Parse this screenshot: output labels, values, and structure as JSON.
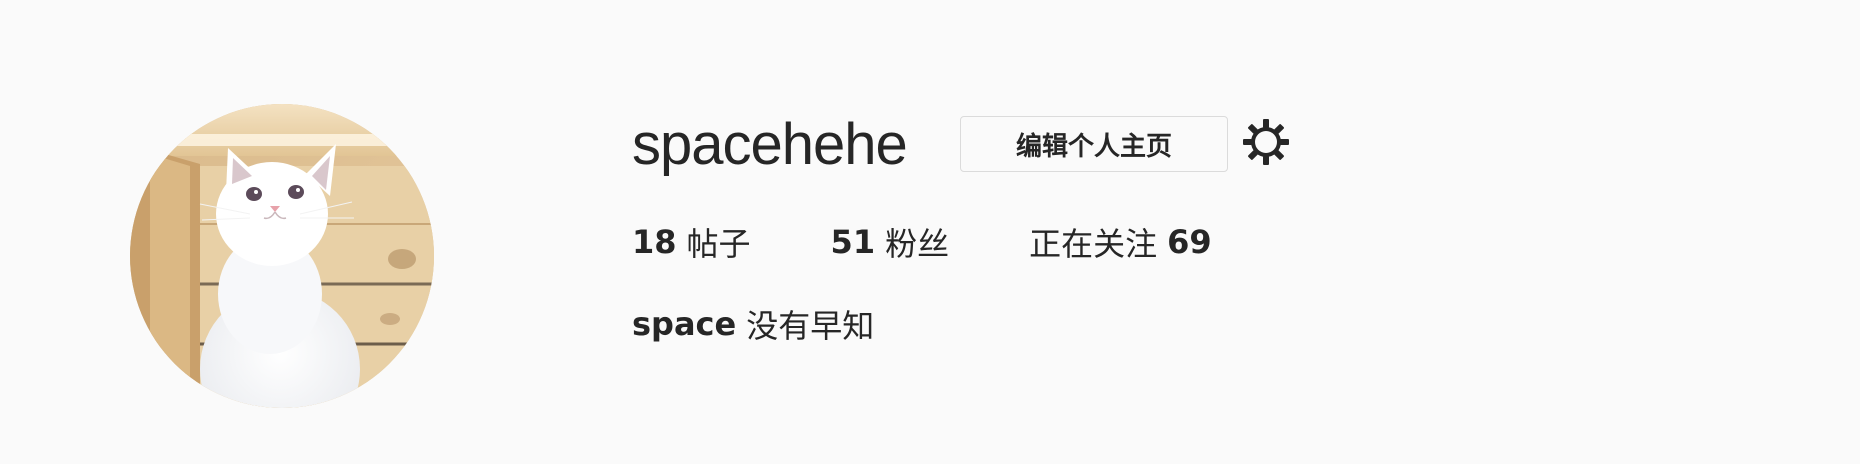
{
  "profile": {
    "username": "spacehehe",
    "edit_button_label": "编辑个人主页",
    "settings_icon": "gear-icon",
    "avatar_subject": "white kitten in wooden crate",
    "stats": {
      "posts_count": "18",
      "posts_label": "帖子",
      "followers_count": "51",
      "followers_label": "粉丝",
      "following_label": "正在关注",
      "following_count": "69"
    },
    "bio": {
      "full_name": "space",
      "text": "没有早知"
    }
  },
  "colors": {
    "background": "#fafafa",
    "text": "#262626",
    "border": "#dbdbdb"
  }
}
